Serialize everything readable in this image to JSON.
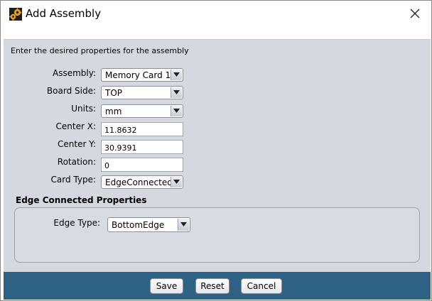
{
  "window": {
    "title": "Add Assembly",
    "app_icon": "gears-icon",
    "close_icon": "close-icon"
  },
  "intro_text": "Enter the desired properties for the assembly",
  "form": {
    "assembly": {
      "label": "Assembly:",
      "value": "Memory Card 1"
    },
    "board_side": {
      "label": "Board Side:",
      "value": "TOP"
    },
    "units": {
      "label": "Units:",
      "value": "mm"
    },
    "center_x": {
      "label": "Center X:",
      "value": "11.8632"
    },
    "center_y": {
      "label": "Center Y:",
      "value": "30.9391"
    },
    "rotation": {
      "label": "Rotation:",
      "value": "0"
    },
    "card_type": {
      "label": "Card Type:",
      "value": "EdgeConnected"
    }
  },
  "edge_section": {
    "title": "Edge Connected Properties",
    "edge_type": {
      "label": "Edge Type:",
      "value": "BottomEdge"
    }
  },
  "buttons": {
    "save": "Save",
    "reset": "Reset",
    "cancel": "Cancel"
  },
  "colors": {
    "content_bg": "#d6d8e0",
    "footer_bg": "#2e6284",
    "icon_orange": "#e8a21c"
  }
}
